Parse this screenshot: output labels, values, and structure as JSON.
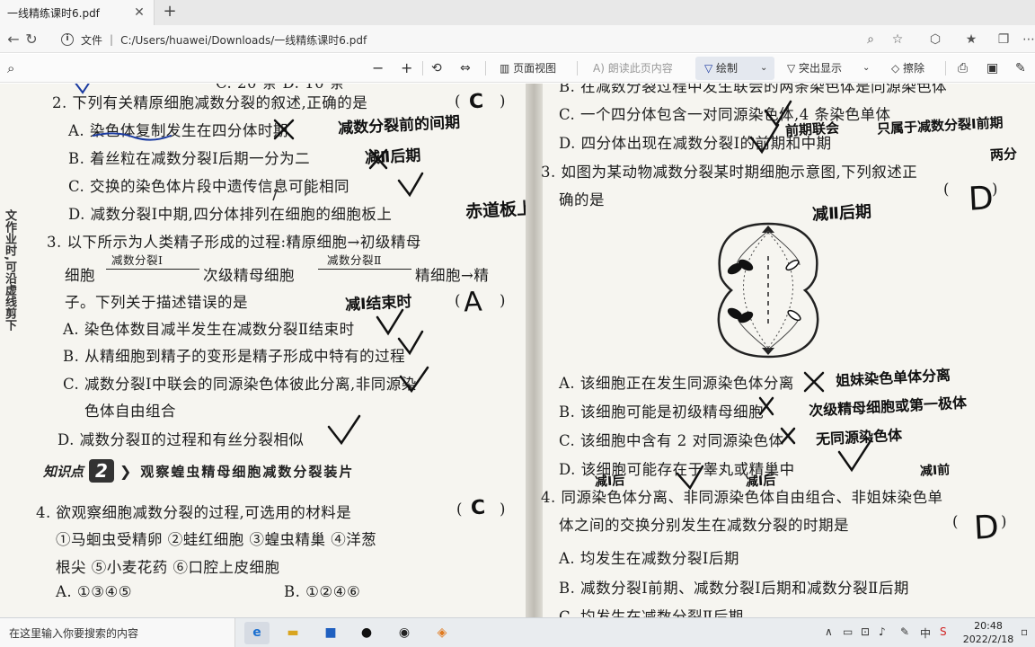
{
  "browser": {
    "tab_title": "一线精练课时6.pdf",
    "address_label": "文件",
    "address_path": "C:/Users/huawei/Downloads/一线精练课时6.pdf"
  },
  "pdf_toolbar": {
    "page_view": "页面视图",
    "read_aloud": "朗读此页内容",
    "draw": "绘制",
    "highlight": "突出显示",
    "erase": "擦除"
  },
  "left_page": {
    "top_fragment": "C. 20 条            D. 10 条",
    "q2": "2. 下列有关精原细胞减数分裂的叙述,正确的是",
    "q2_a": "A. 染色体复制发生在四分体时期",
    "q2_b": "B. 着丝粒在减数分裂Ⅰ后期一分为二",
    "q2_c": "C. 交换的染色体片段中遗传信息可能相同",
    "q2_d": "D. 减数分裂Ⅰ中期,四分体排列在细胞的细胞板上",
    "q3": "3. 以下所示为人类精子形成的过程:精原细胞→初级精母",
    "q3_l2_a": "细胞",
    "q3_arrow1": "减数分裂Ⅰ",
    "q3_l2_b": "次级精母细胞",
    "q3_arrow2": "减数分裂Ⅱ",
    "q3_l2_c": "精细胞→精",
    "q3_l3": "子。下列关于描述错误的是",
    "q3_a": "A. 染色体数目减半发生在减数分裂Ⅱ结束时",
    "q3_b": "B. 从精细胞到精子的变形是精子形成中特有的过程",
    "q3_c": "C. 减数分裂Ⅰ中联会的同源染色体彼此分离,非同源染",
    "q3_c2": "色体自由组合",
    "q3_d": "D. 减数分裂Ⅱ的过程和有丝分裂相似",
    "kp_label": "知识点",
    "kp_num": "2",
    "kp_title": "观察蝗虫精母细胞减数分裂装片",
    "q4": "4. 欲观察细胞减数分裂的过程,可选用的材料是",
    "q4_opts1": "①马蛔虫受精卵   ②蛙红细胞   ③蝗虫精巢   ④洋葱",
    "q4_opts2": "根尖   ⑤小麦花药   ⑥口腔上皮细胞",
    "q4_a": "A. ①③④⑤",
    "q4_b": "B. ①②④⑥",
    "paren_open": "(",
    "paren_close": ")",
    "margin_note": "文作业时,可沿虚线剪下"
  },
  "right_page": {
    "q2_b": "B. 在减数分裂过程中发生联会的两条染色体是同源染色体",
    "q2_c": "C. 一个四分体包含一对同源染色体,4 条染色单体",
    "q2_d": "D. 四分体出现在减数分裂Ⅰ的前期和中期",
    "q3": "3. 如图为某动物减数分裂某时期细胞示意图,下列叙述正",
    "q3_l2": "确的是",
    "q3_a": "A. 该细胞正在发生同源染色体分离",
    "q3_b": "B. 该细胞可能是初级精母细胞",
    "q3_c": "C. 该细胞中含有 2 对同源染色体",
    "q3_d": "D. 该细胞可能存在于睾丸或精巢中",
    "q4": "4. 同源染色体分离、非同源染色体自由组合、非姐妹染色单",
    "q4_l2": "体之间的交换分别发生在减数分裂的时期是",
    "q4_a": "A. 均发生在减数分裂Ⅰ后期",
    "q4_b": "B. 减数分裂Ⅰ前期、减数分裂Ⅰ后期和减数分裂Ⅱ后期",
    "q4_c_fragment": "C. 均发生在减数分裂Ⅱ后期",
    "paren_open": "(",
    "paren_close": ")"
  },
  "handwriting": {
    "l_q2_ans": "C",
    "l_q2a_note": "减数分裂前的间期",
    "l_q2b_note": "减Ⅱ后期",
    "l_q2d_note": "赤道板上",
    "l_q3_note": "减Ⅰ结束时",
    "l_q3_ans": "A",
    "l_q4_ans": "C",
    "r_q2_note1": "前期联会",
    "r_q2_note2": "只属于减数分裂Ⅰ前期",
    "r_q2_note3": "两分",
    "r_q3_note_stage": "减Ⅱ后期",
    "r_q3_ans": "D",
    "r_q3a_note": "姐妹染色单体分离",
    "r_q3b_note": "次级精母细胞或第一极体",
    "r_q3c_note": "无同源染色体",
    "r_q4_note1": "减Ⅰ后",
    "r_q4_note2": "减Ⅰ后",
    "r_q4_note3": "减Ⅰ前",
    "r_q4_ans": "D"
  },
  "taskbar": {
    "search_placeholder": "在这里输入你要搜索的内容",
    "time": "20:48",
    "date": "2022/2/18",
    "ime": "中"
  }
}
